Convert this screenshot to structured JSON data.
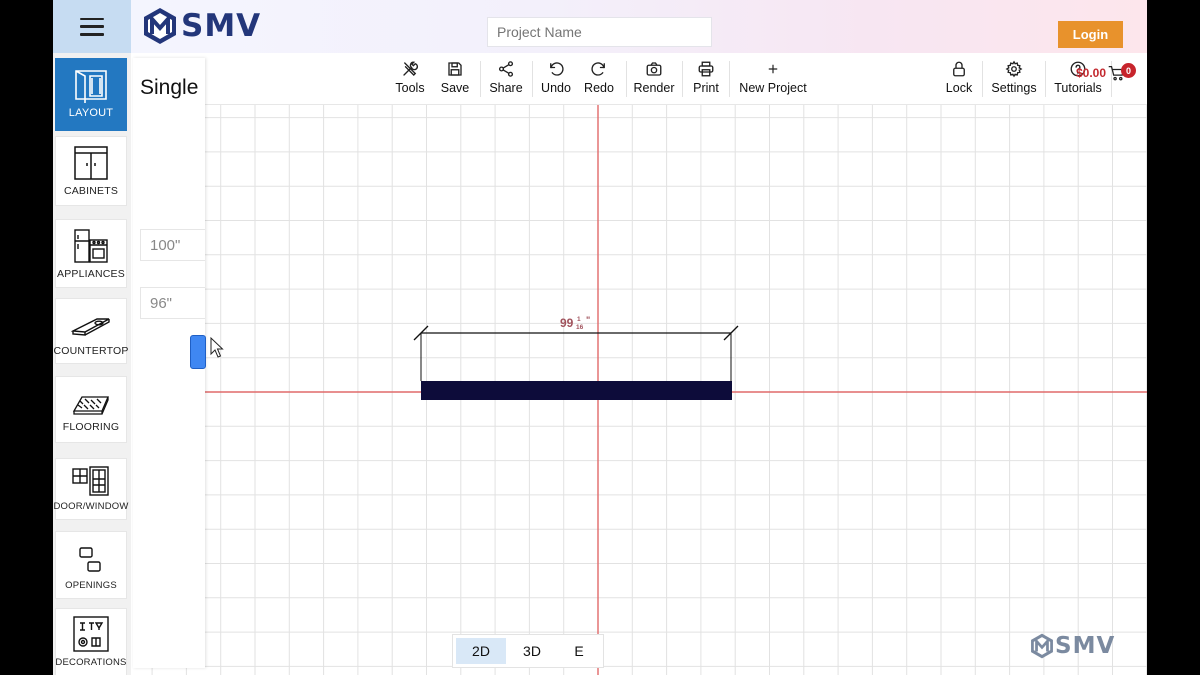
{
  "header": {
    "logo_text": "SMV",
    "project_placeholder": "Project Name",
    "login_label": "Login"
  },
  "toolbar": {
    "items": [
      {
        "label": "Tools",
        "icon": "tools-icon"
      },
      {
        "label": "Save",
        "icon": "save-icon"
      },
      {
        "label": "Share",
        "icon": "share-icon"
      },
      {
        "label": "Undo",
        "icon": "undo-icon"
      },
      {
        "label": "Redo",
        "icon": "redo-icon"
      },
      {
        "label": "Render",
        "icon": "camera-icon"
      },
      {
        "label": "Print",
        "icon": "printer-icon"
      },
      {
        "label": "New Project",
        "icon": "plus-icon"
      },
      {
        "label": "Lock",
        "icon": "lock-icon"
      },
      {
        "label": "Settings",
        "icon": "gear-icon"
      },
      {
        "label": "Tutorials",
        "icon": "question-icon"
      }
    ],
    "cart_amount": "$0.00",
    "cart_count": "0"
  },
  "sidebar": {
    "items": [
      {
        "label": "LAYOUT",
        "icon": "layout-icon",
        "active": true
      },
      {
        "label": "CABINETS",
        "icon": "cabinet-icon"
      },
      {
        "label": "APPLIANCES",
        "icon": "appliance-icon"
      },
      {
        "label": "COUNTERTOP",
        "icon": "countertop-icon"
      },
      {
        "label": "FLOORING",
        "icon": "flooring-icon"
      },
      {
        "label": "DOOR/WINDOW",
        "icon": "door-window-icon"
      },
      {
        "label": "OPENINGS",
        "icon": "openings-icon"
      },
      {
        "label": "DECORATIONS",
        "icon": "decorations-icon"
      }
    ]
  },
  "panel": {
    "title": "Single",
    "width_value": "100\"",
    "height_value": "96\""
  },
  "canvas": {
    "dimension_whole": "99",
    "dimension_num": "1",
    "dimension_den": "16",
    "dimension_unit": "\"",
    "wall_color": "#0d0c3a",
    "axis_color": "#e06a6a"
  },
  "view_toggle": {
    "options": [
      {
        "label": "2D",
        "active": true
      },
      {
        "label": "3D",
        "active": false
      },
      {
        "label": "E",
        "active": false
      }
    ]
  },
  "watermark_text": "SMV",
  "colors": {
    "brand": "#23367a",
    "accent": "#2378c1",
    "login": "#e8922c"
  }
}
